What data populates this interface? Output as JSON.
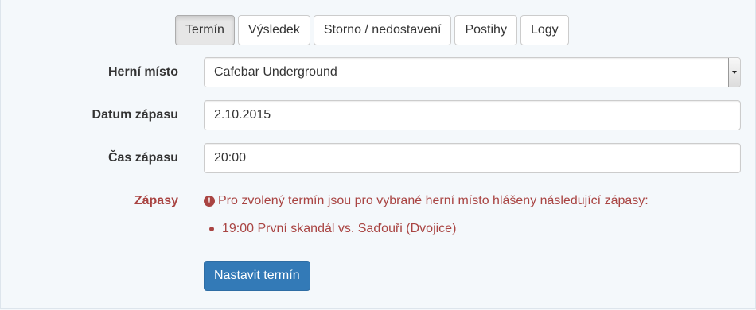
{
  "tabs": [
    {
      "label": "Termín",
      "active": true
    },
    {
      "label": "Výsledek",
      "active": false
    },
    {
      "label": "Storno / nedostavení",
      "active": false
    },
    {
      "label": "Postihy",
      "active": false
    },
    {
      "label": "Logy",
      "active": false
    }
  ],
  "form": {
    "venue": {
      "label": "Herní místo",
      "value": "Cafebar Underground"
    },
    "date": {
      "label": "Datum zápasu",
      "value": "2.10.2015"
    },
    "time": {
      "label": "Čas zápasu",
      "value": "20:00"
    },
    "matches": {
      "label": "Zápasy",
      "warning_text": "Pro zvolený termín jsou pro vybrané herní místo hlášeny následující zápasy:",
      "warning_icon": "exclamation-circle-icon",
      "items": [
        "19:00 První skandál vs. Saďouři (Dvojice)"
      ]
    },
    "submit_label": "Nastavit termín"
  },
  "colors": {
    "primary": "#337ab7",
    "danger": "#a94442",
    "background": "#f4f8fb"
  }
}
